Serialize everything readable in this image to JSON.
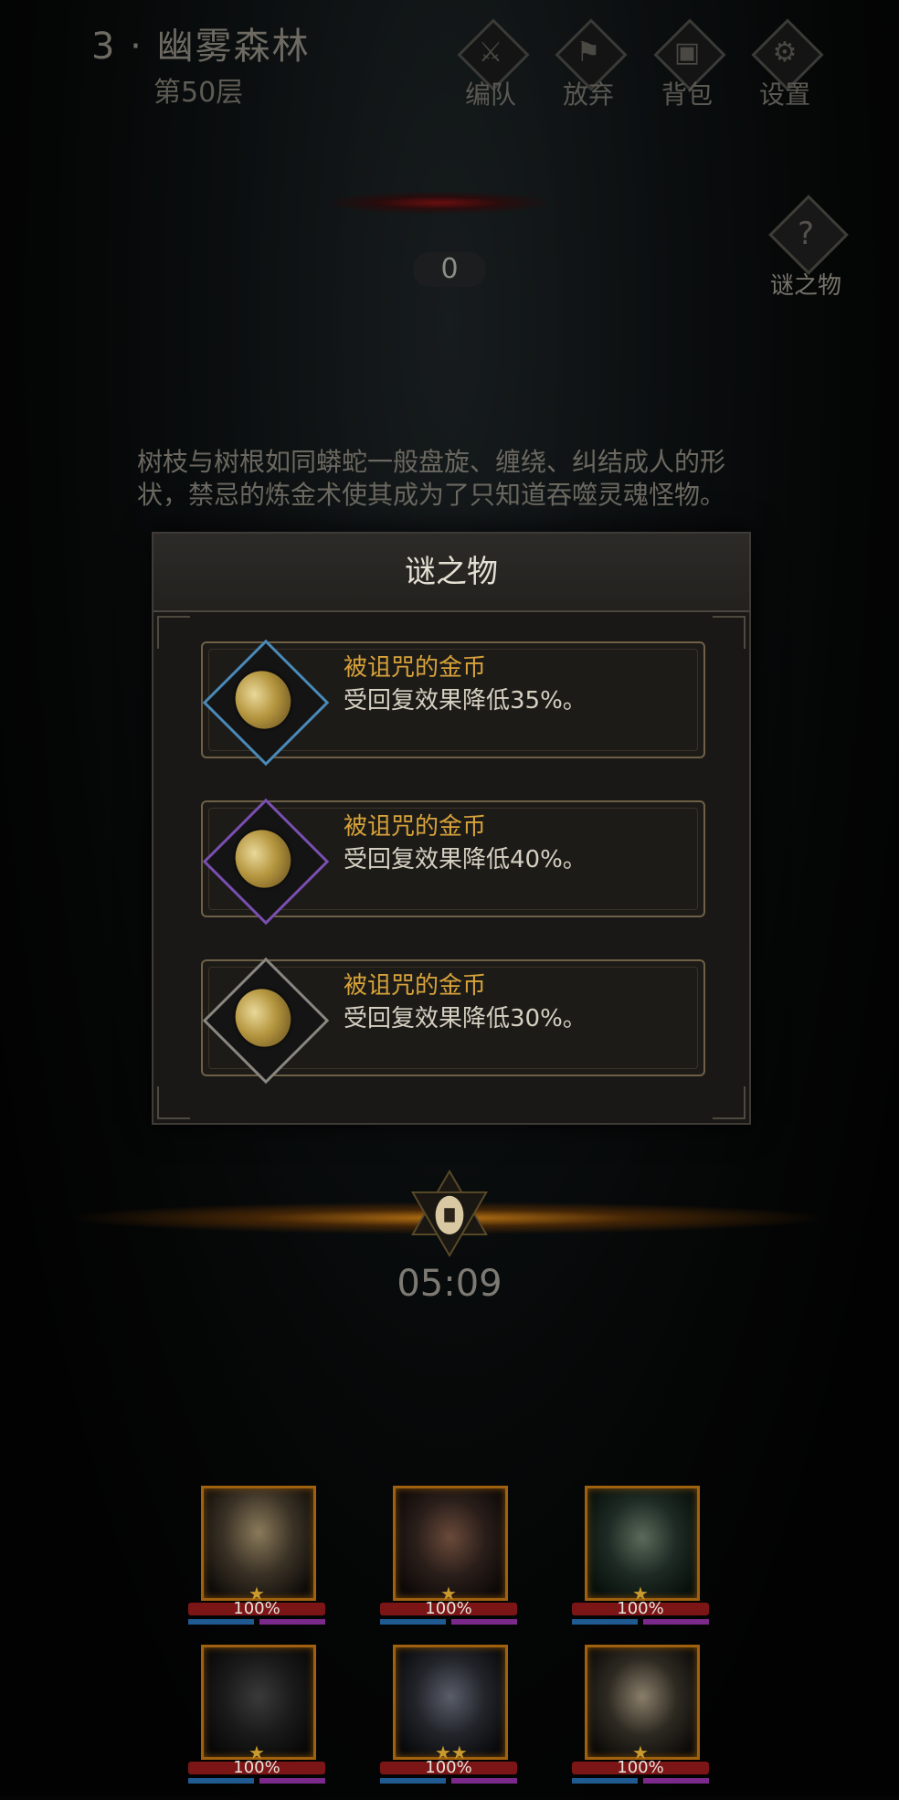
{
  "header": {
    "title": "3 · 幽雾森林",
    "floor": "第50层",
    "buttons": [
      {
        "label": "编队",
        "icon": "team-icon"
      },
      {
        "label": "放弃",
        "icon": "abandon-icon"
      },
      {
        "label": "背包",
        "icon": "bag-icon"
      },
      {
        "label": "设置",
        "icon": "gear-icon"
      }
    ]
  },
  "stage": {
    "counter": "0",
    "mystery_label": "谜之物"
  },
  "story_text": "树枝与树根如同蟒蛇一般盘旋、缠绕、纠结成人的形状，禁忌的炼金术使其成为了只知道吞噬灵魂怪物。",
  "dialog": {
    "title": "谜之物",
    "items": [
      {
        "name": "被诅咒的金币",
        "desc": "受回复效果降低35%。",
        "rarity_color": "#4a8ab8"
      },
      {
        "name": "被诅咒的金币",
        "desc": "受回复效果降低40%。",
        "rarity_color": "#7a4fb2"
      },
      {
        "name": "被诅咒的金币",
        "desc": "受回复效果降低30%。",
        "rarity_color": "#8a8780"
      }
    ]
  },
  "timer": "05:09",
  "heroes": [
    {
      "hp": "100%"
    },
    {
      "hp": "100%"
    },
    {
      "hp": "100%"
    },
    {
      "hp": "100%"
    },
    {
      "hp": "100%"
    },
    {
      "hp": "100%"
    }
  ]
}
